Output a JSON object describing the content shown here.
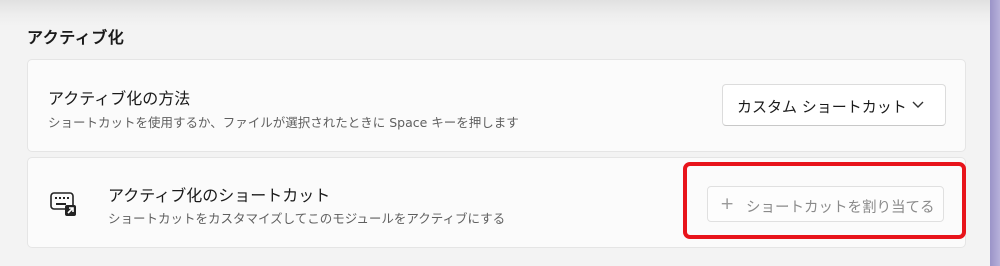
{
  "section": {
    "heading": "アクティブ化"
  },
  "activation_method": {
    "title": "アクティブ化の方法",
    "description": "ショートカットを使用するか、ファイルが選択されたときに Space キーを押します",
    "dropdown": {
      "selected": "カスタム ショートカット",
      "icon": "chevron-down-icon"
    }
  },
  "activation_shortcut": {
    "icon": "keyboard-shortcut-icon",
    "title": "アクティブ化のショートカット",
    "description": "ショートカットをカスタマイズしてこのモジュールをアクティブにする",
    "assign_button": {
      "plus": "+",
      "label": "ショートカットを割り当てる"
    }
  },
  "colors": {
    "highlight": "#e8141b",
    "accent": "#9b94c8"
  }
}
